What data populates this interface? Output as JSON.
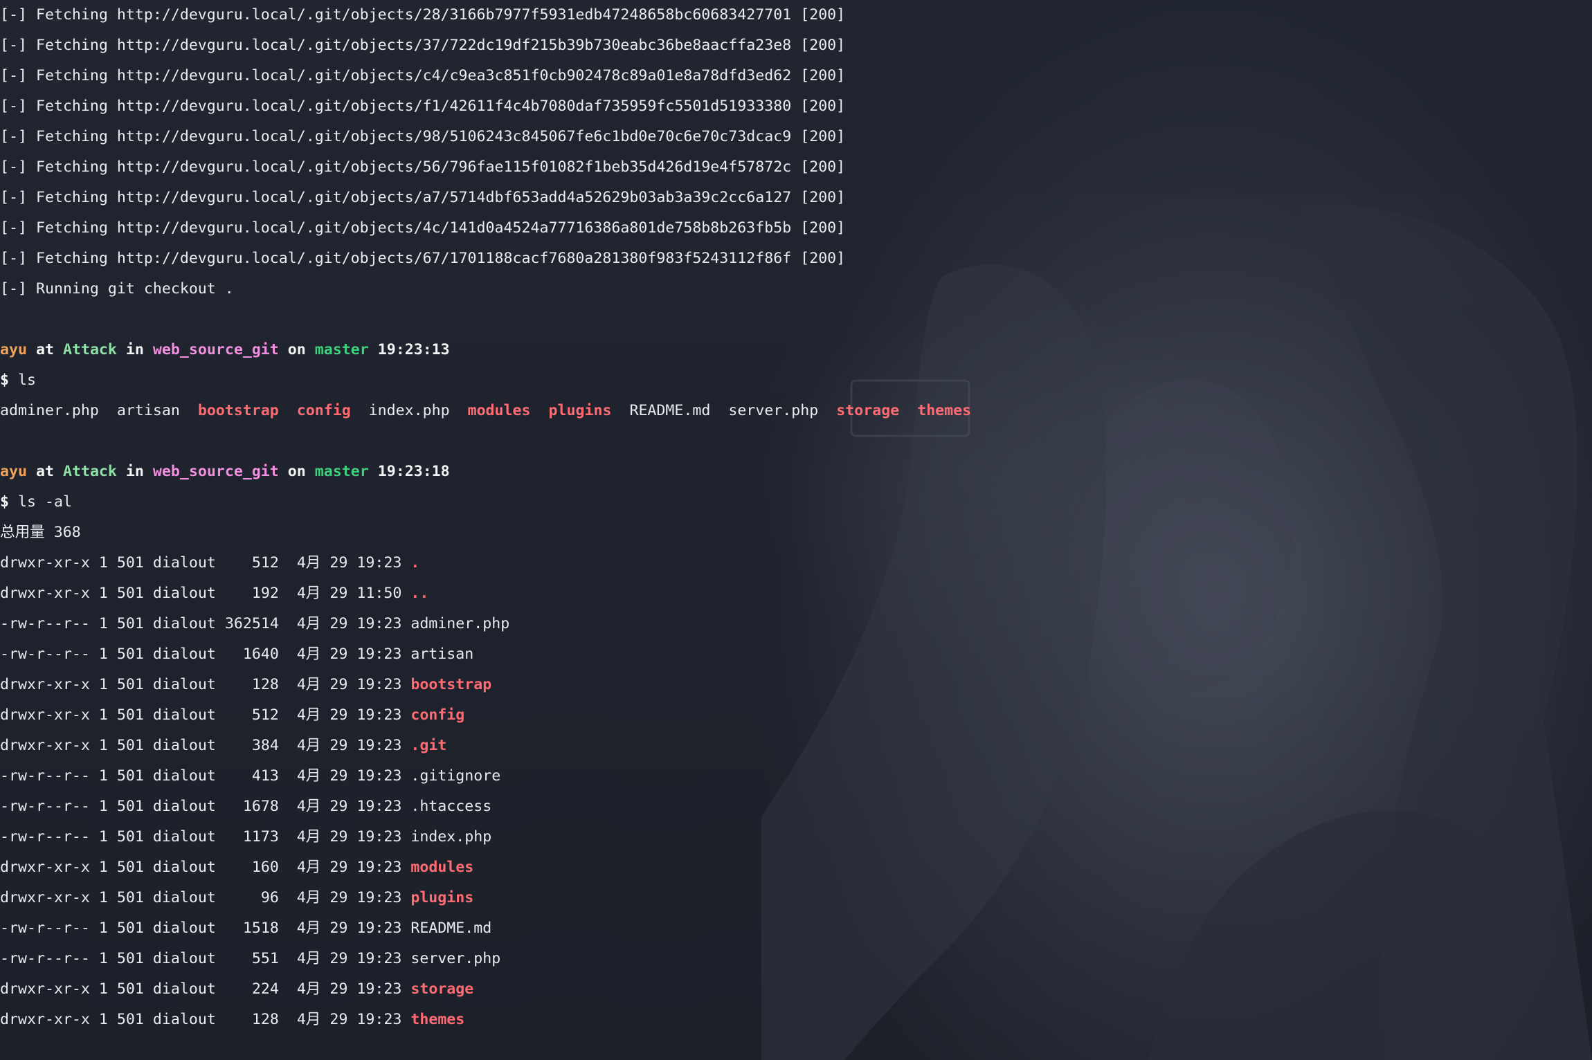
{
  "fetch_lines": [
    "[-] Fetching http://devguru.local/.git/objects/28/3166b7977f5931edb47248658bc60683427701 [200]",
    "[-] Fetching http://devguru.local/.git/objects/37/722dc19df215b39b730eabc36be8aacffa23e8 [200]",
    "[-] Fetching http://devguru.local/.git/objects/c4/c9ea3c851f0cb902478c89a01e8a78dfd3ed62 [200]",
    "[-] Fetching http://devguru.local/.git/objects/f1/42611f4c4b7080daf735959fc5501d51933380 [200]",
    "[-] Fetching http://devguru.local/.git/objects/98/5106243c845067fe6c1bd0e70c6e70c73dcac9 [200]",
    "[-] Fetching http://devguru.local/.git/objects/56/796fae115f01082f1beb35d426d19e4f57872c [200]",
    "[-] Fetching http://devguru.local/.git/objects/a7/5714dbf653add4a52629b03ab3a39c2cc6a127 [200]",
    "[-] Fetching http://devguru.local/.git/objects/4c/141d0a4524a77716386a801de758b8b263fb5b [200]",
    "[-] Fetching http://devguru.local/.git/objects/67/1701188cacf7680a281380f983f5243112f86f [200]",
    "[-] Running git checkout ."
  ],
  "prompt1": {
    "user": "ayu",
    "at": "at",
    "host": "Attack",
    "in": "in",
    "dir": "web_source_git",
    "on": "on",
    "branch": "master",
    "time": "19:23:13",
    "symbol": "$",
    "command": "ls"
  },
  "ls_output": [
    {
      "name": "adminer.php",
      "is_dir": false
    },
    {
      "name": "artisan",
      "is_dir": false
    },
    {
      "name": "bootstrap",
      "is_dir": true
    },
    {
      "name": "config",
      "is_dir": true
    },
    {
      "name": "index.php",
      "is_dir": false
    },
    {
      "name": "modules",
      "is_dir": true
    },
    {
      "name": "plugins",
      "is_dir": true
    },
    {
      "name": "README.md",
      "is_dir": false
    },
    {
      "name": "server.php",
      "is_dir": false
    },
    {
      "name": "storage",
      "is_dir": true
    },
    {
      "name": "themes",
      "is_dir": true
    }
  ],
  "prompt2": {
    "user": "ayu",
    "at": "at",
    "host": "Attack",
    "in": "in",
    "dir": "web_source_git",
    "on": "on",
    "branch": "master",
    "time": "19:23:18",
    "symbol": "$",
    "command": "ls -al"
  },
  "total_line": "总用量 368",
  "ls_al_rows": [
    {
      "perms": "drwxr-xr-x",
      "links": "1",
      "owner": "501",
      "group": "dialout",
      "size": "512",
      "month": "4月",
      "day": "29",
      "time": "19:23",
      "name": ".",
      "is_dir": true
    },
    {
      "perms": "drwxr-xr-x",
      "links": "1",
      "owner": "501",
      "group": "dialout",
      "size": "192",
      "month": "4月",
      "day": "29",
      "time": "11:50",
      "name": "..",
      "is_dir": true
    },
    {
      "perms": "-rw-r--r--",
      "links": "1",
      "owner": "501",
      "group": "dialout",
      "size": "362514",
      "month": "4月",
      "day": "29",
      "time": "19:23",
      "name": "adminer.php",
      "is_dir": false
    },
    {
      "perms": "-rw-r--r--",
      "links": "1",
      "owner": "501",
      "group": "dialout",
      "size": "1640",
      "month": "4月",
      "day": "29",
      "time": "19:23",
      "name": "artisan",
      "is_dir": false
    },
    {
      "perms": "drwxr-xr-x",
      "links": "1",
      "owner": "501",
      "group": "dialout",
      "size": "128",
      "month": "4月",
      "day": "29",
      "time": "19:23",
      "name": "bootstrap",
      "is_dir": true
    },
    {
      "perms": "drwxr-xr-x",
      "links": "1",
      "owner": "501",
      "group": "dialout",
      "size": "512",
      "month": "4月",
      "day": "29",
      "time": "19:23",
      "name": "config",
      "is_dir": true
    },
    {
      "perms": "drwxr-xr-x",
      "links": "1",
      "owner": "501",
      "group": "dialout",
      "size": "384",
      "month": "4月",
      "day": "29",
      "time": "19:23",
      "name": ".git",
      "is_dir": true
    },
    {
      "perms": "-rw-r--r--",
      "links": "1",
      "owner": "501",
      "group": "dialout",
      "size": "413",
      "month": "4月",
      "day": "29",
      "time": "19:23",
      "name": ".gitignore",
      "is_dir": false
    },
    {
      "perms": "-rw-r--r--",
      "links": "1",
      "owner": "501",
      "group": "dialout",
      "size": "1678",
      "month": "4月",
      "day": "29",
      "time": "19:23",
      "name": ".htaccess",
      "is_dir": false
    },
    {
      "perms": "-rw-r--r--",
      "links": "1",
      "owner": "501",
      "group": "dialout",
      "size": "1173",
      "month": "4月",
      "day": "29",
      "time": "19:23",
      "name": "index.php",
      "is_dir": false
    },
    {
      "perms": "drwxr-xr-x",
      "links": "1",
      "owner": "501",
      "group": "dialout",
      "size": "160",
      "month": "4月",
      "day": "29",
      "time": "19:23",
      "name": "modules",
      "is_dir": true
    },
    {
      "perms": "drwxr-xr-x",
      "links": "1",
      "owner": "501",
      "group": "dialout",
      "size": "96",
      "month": "4月",
      "day": "29",
      "time": "19:23",
      "name": "plugins",
      "is_dir": true
    },
    {
      "perms": "-rw-r--r--",
      "links": "1",
      "owner": "501",
      "group": "dialout",
      "size": "1518",
      "month": "4月",
      "day": "29",
      "time": "19:23",
      "name": "README.md",
      "is_dir": false
    },
    {
      "perms": "-rw-r--r--",
      "links": "1",
      "owner": "501",
      "group": "dialout",
      "size": "551",
      "month": "4月",
      "day": "29",
      "time": "19:23",
      "name": "server.php",
      "is_dir": false
    },
    {
      "perms": "drwxr-xr-x",
      "links": "1",
      "owner": "501",
      "group": "dialout",
      "size": "224",
      "month": "4月",
      "day": "29",
      "time": "19:23",
      "name": "storage",
      "is_dir": true
    },
    {
      "perms": "drwxr-xr-x",
      "links": "1",
      "owner": "501",
      "group": "dialout",
      "size": "128",
      "month": "4月",
      "day": "29",
      "time": "19:23",
      "name": "themes",
      "is_dir": true
    }
  ],
  "colors": {
    "background": "#1f2430",
    "text": "#e9ebee",
    "user": "#f0a35a",
    "host": "#8fe0a8",
    "dir": "#f28fe0",
    "branch": "#3fcf7c",
    "folder": "#ff6b73"
  }
}
